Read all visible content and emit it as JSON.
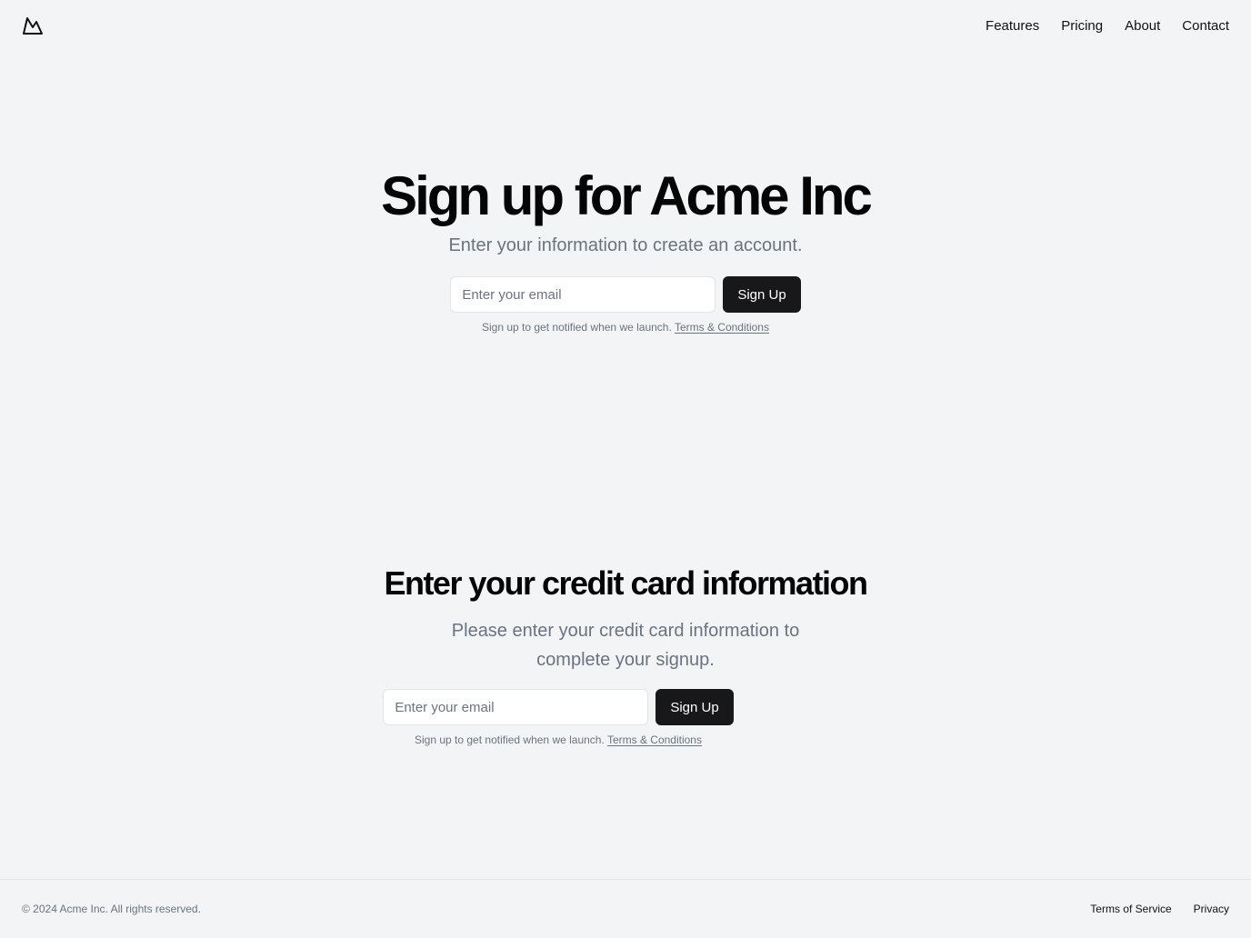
{
  "header": {
    "logo_icon": "mountain-icon",
    "nav": [
      {
        "label": "Features"
      },
      {
        "label": "Pricing"
      },
      {
        "label": "About"
      },
      {
        "label": "Contact"
      }
    ]
  },
  "hero": {
    "title": "Sign up for Acme Inc",
    "subtitle": "Enter your information to create an account.",
    "email_placeholder": "Enter your email",
    "button_label": "Sign Up",
    "note_text": "Sign up to get notified when we launch.",
    "note_link": "Terms & Conditions"
  },
  "credit_card": {
    "title": "Enter your credit card information",
    "subtitle": "Please enter your credit card information to complete your signup.",
    "email_placeholder": "Enter your email",
    "button_label": "Sign Up",
    "note_text": "Sign up to get notified when we launch.",
    "note_link": "Terms & Conditions"
  },
  "footer": {
    "copyright": "© 2024 Acme Inc. All rights reserved.",
    "links": [
      {
        "label": "Terms of Service"
      },
      {
        "label": "Privacy"
      }
    ]
  },
  "colors": {
    "background": "#f3f4f6",
    "button": "#18181b",
    "muted_text": "#6b7280"
  }
}
